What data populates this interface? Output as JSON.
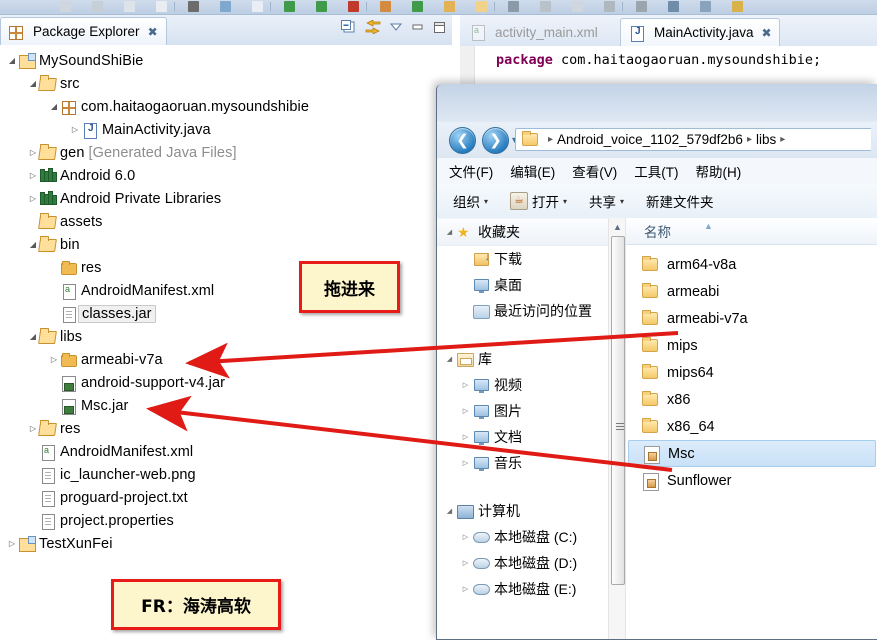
{
  "ide": {
    "toolbar_name": "eclipse-main-toolbar",
    "package_explorer": {
      "tab_label": "Package Explorer",
      "tab_close": "✖",
      "toolbar_icons": [
        "collapse-all-icon",
        "link-with-editor-icon",
        "view-menu-icon",
        "minimize-icon",
        "maximize-icon"
      ],
      "tree": [
        {
          "label": "MySoundShiBie",
          "indent": 0,
          "twist": "open",
          "icon": "project-icon"
        },
        {
          "label": "src",
          "indent": 1,
          "twist": "open",
          "icon": "source-folder-icon"
        },
        {
          "label": "com.haitaogaoruan.mysoundshibie",
          "indent": 2,
          "twist": "open",
          "icon": "package-icon"
        },
        {
          "label": "MainActivity.java",
          "indent": 3,
          "twist": "closed",
          "icon": "java-file-icon"
        },
        {
          "label": "gen",
          "suffix": " [Generated Java Files]",
          "indent": 1,
          "twist": "closed",
          "icon": "source-folder-icon"
        },
        {
          "label": "Android 6.0",
          "indent": 1,
          "twist": "closed",
          "icon": "library-icon"
        },
        {
          "label": "Android Private Libraries",
          "indent": 1,
          "twist": "closed",
          "icon": "library-icon"
        },
        {
          "label": "assets",
          "indent": 1,
          "twist": "none",
          "icon": "source-folder-icon"
        },
        {
          "label": "bin",
          "indent": 1,
          "twist": "open",
          "icon": "source-folder-icon"
        },
        {
          "label": "res",
          "indent": 2,
          "twist": "none",
          "icon": "folder-icon"
        },
        {
          "label": "AndroidManifest.xml",
          "indent": 2,
          "twist": "none",
          "icon": "xml-file-icon"
        },
        {
          "label": "classes.jar",
          "indent": 2,
          "twist": "none",
          "icon": "file-icon",
          "selected": true
        },
        {
          "label": "libs",
          "indent": 1,
          "twist": "open",
          "icon": "source-folder-icon"
        },
        {
          "label": "armeabi-v7a",
          "indent": 2,
          "twist": "closed",
          "icon": "folder-icon"
        },
        {
          "label": "android-support-v4.jar",
          "indent": 2,
          "twist": "none",
          "icon": "jar-file-icon"
        },
        {
          "label": "Msc.jar",
          "indent": 2,
          "twist": "none",
          "icon": "jar-file-icon"
        },
        {
          "label": "res",
          "indent": 1,
          "twist": "closed",
          "icon": "source-folder-icon"
        },
        {
          "label": "AndroidManifest.xml",
          "indent": 1,
          "twist": "none",
          "icon": "xml-file-icon"
        },
        {
          "label": "ic_launcher-web.png",
          "indent": 1,
          "twist": "none",
          "icon": "file-icon"
        },
        {
          "label": "proguard-project.txt",
          "indent": 1,
          "twist": "none",
          "icon": "file-icon"
        },
        {
          "label": "project.properties",
          "indent": 1,
          "twist": "none",
          "icon": "file-icon"
        },
        {
          "label": "TestXunFei",
          "indent": 0,
          "twist": "closed",
          "icon": "project-icon"
        }
      ]
    },
    "editor": {
      "tabs": [
        {
          "label": "activity_main.xml",
          "icon": "xml-file-icon",
          "active": false
        },
        {
          "label": "MainActivity.java",
          "icon": "java-file-icon",
          "active": true,
          "close": "✖"
        }
      ],
      "code_keyword": "package",
      "code_rest": " com.haitaogaoruan.mysoundshibie;"
    }
  },
  "annotations": {
    "drag_box": "拖进来",
    "signature_box": "FR：海涛高软",
    "arrow_color": "#e01b16",
    "box_fill": "#fdf5cc",
    "box_border": "#e81b18"
  },
  "explorer": {
    "nav_back_icon": "back-arrow-icon",
    "nav_forward_icon": "forward-arrow-icon",
    "history_caret": "▾",
    "address": {
      "folder_icon": "folder-icon",
      "crumbs": [
        "Android_voice_1102_579df2b6",
        "libs"
      ],
      "separator": "▸"
    },
    "menubar": [
      "文件(F)",
      "编辑(E)",
      "查看(V)",
      "工具(T)",
      "帮助(H)"
    ],
    "toolbar": [
      {
        "label": "组织",
        "caret": "▾",
        "icon": null
      },
      {
        "label": "打开",
        "caret": "▾",
        "icon": "java-app-icon"
      },
      {
        "label": "共享",
        "caret": "▾",
        "icon": null
      },
      {
        "label": "新建文件夹",
        "caret": "",
        "icon": null
      }
    ],
    "nav_pane": [
      {
        "label": "收藏夹",
        "indent": 0,
        "twist": "open",
        "icon": "favorites-star-icon",
        "header": true
      },
      {
        "label": "下载",
        "indent": 1,
        "twist": "none",
        "icon": "downloads-icon"
      },
      {
        "label": "桌面",
        "indent": 1,
        "twist": "none",
        "icon": "desktop-icon"
      },
      {
        "label": "最近访问的位置",
        "indent": 1,
        "twist": "none",
        "icon": "recent-places-icon"
      },
      {
        "label": "",
        "indent": 0,
        "twist": "none",
        "icon": "spacer",
        "spacer": true
      },
      {
        "label": "库",
        "indent": 0,
        "twist": "open",
        "icon": "library-box-icon"
      },
      {
        "label": "视频",
        "indent": 1,
        "twist": "closed",
        "icon": "video-icon"
      },
      {
        "label": "图片",
        "indent": 1,
        "twist": "closed",
        "icon": "pictures-icon"
      },
      {
        "label": "文档",
        "indent": 1,
        "twist": "closed",
        "icon": "documents-icon"
      },
      {
        "label": "音乐",
        "indent": 1,
        "twist": "closed",
        "icon": "music-icon"
      },
      {
        "label": "",
        "indent": 0,
        "twist": "none",
        "icon": "spacer",
        "spacer": true
      },
      {
        "label": "计算机",
        "indent": 0,
        "twist": "open",
        "icon": "computer-icon"
      },
      {
        "label": "本地磁盘 (C:)",
        "indent": 1,
        "twist": "closed",
        "icon": "disk-icon"
      },
      {
        "label": "本地磁盘 (D:)",
        "indent": 1,
        "twist": "closed",
        "icon": "disk-icon"
      },
      {
        "label": "本地磁盘 (E:)",
        "indent": 1,
        "twist": "closed",
        "icon": "disk-icon"
      }
    ],
    "list_header": "名称",
    "list_sort_indicator": "▲",
    "files": [
      {
        "name": "arm64-v8a",
        "icon": "folder-icon",
        "selected": false
      },
      {
        "name": "armeabi",
        "icon": "folder-icon",
        "selected": false
      },
      {
        "name": "armeabi-v7a",
        "icon": "folder-icon",
        "selected": false
      },
      {
        "name": "mips",
        "icon": "folder-icon",
        "selected": false
      },
      {
        "name": "mips64",
        "icon": "folder-icon",
        "selected": false
      },
      {
        "name": "x86",
        "icon": "folder-icon",
        "selected": false
      },
      {
        "name": "x86_64",
        "icon": "folder-icon",
        "selected": false
      },
      {
        "name": "Msc",
        "icon": "jar-file-icon",
        "selected": true
      },
      {
        "name": "Sunflower",
        "icon": "jar-file-icon",
        "selected": false
      }
    ]
  }
}
